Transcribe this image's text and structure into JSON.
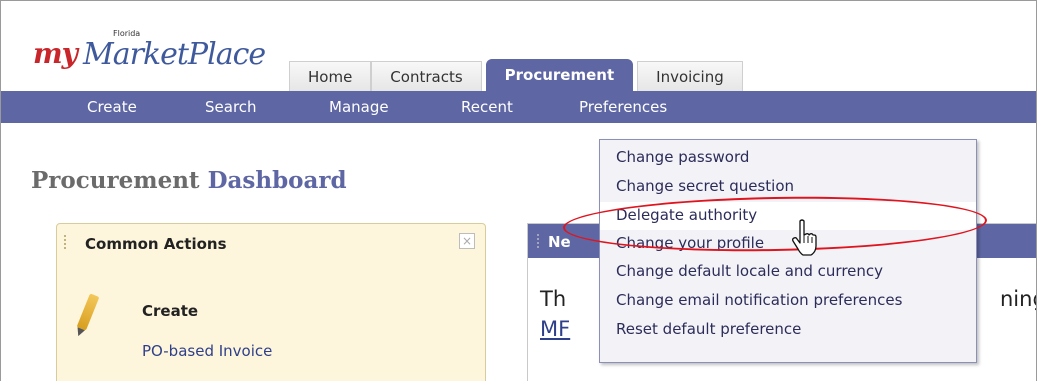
{
  "logo": {
    "prefix": "my",
    "name": "MarketPlace",
    "state_tag": "Florida"
  },
  "tabs": [
    {
      "label": "Home"
    },
    {
      "label": "Contracts"
    },
    {
      "label": "Procurement"
    },
    {
      "label": "Invoicing"
    }
  ],
  "subnav": [
    {
      "label": "Create"
    },
    {
      "label": "Search"
    },
    {
      "label": "Manage"
    },
    {
      "label": "Recent"
    },
    {
      "label": "Preferences"
    }
  ],
  "page_title": {
    "part1": "Procurement",
    "part2": "Dashboard"
  },
  "common_actions": {
    "title": "Common Actions",
    "close_glyph": "×",
    "create_label": "Create",
    "po_invoice_link": "PO-based Invoice"
  },
  "news": {
    "title": "Ne",
    "text_left": "Th",
    "text_right": "ning",
    "link": "MF"
  },
  "preferences_menu": {
    "items": [
      {
        "label": "Change password"
      },
      {
        "label": "Change secret question"
      },
      {
        "label": "Delegate authority"
      },
      {
        "label": "Change your profile"
      },
      {
        "label": "Change default locale and currency"
      },
      {
        "label": "Change email notification preferences"
      },
      {
        "label": "Reset default preference"
      }
    ]
  },
  "colors": {
    "nav_bg": "#5e67a4",
    "highlight_ellipse": "#e0141f",
    "panel_yellow": "#fdf6dc",
    "link_blue": "#2f3f8a"
  },
  "icons": {
    "cursor": "hand-pointer-icon",
    "close": "close-icon",
    "create": "pencil-icon"
  }
}
